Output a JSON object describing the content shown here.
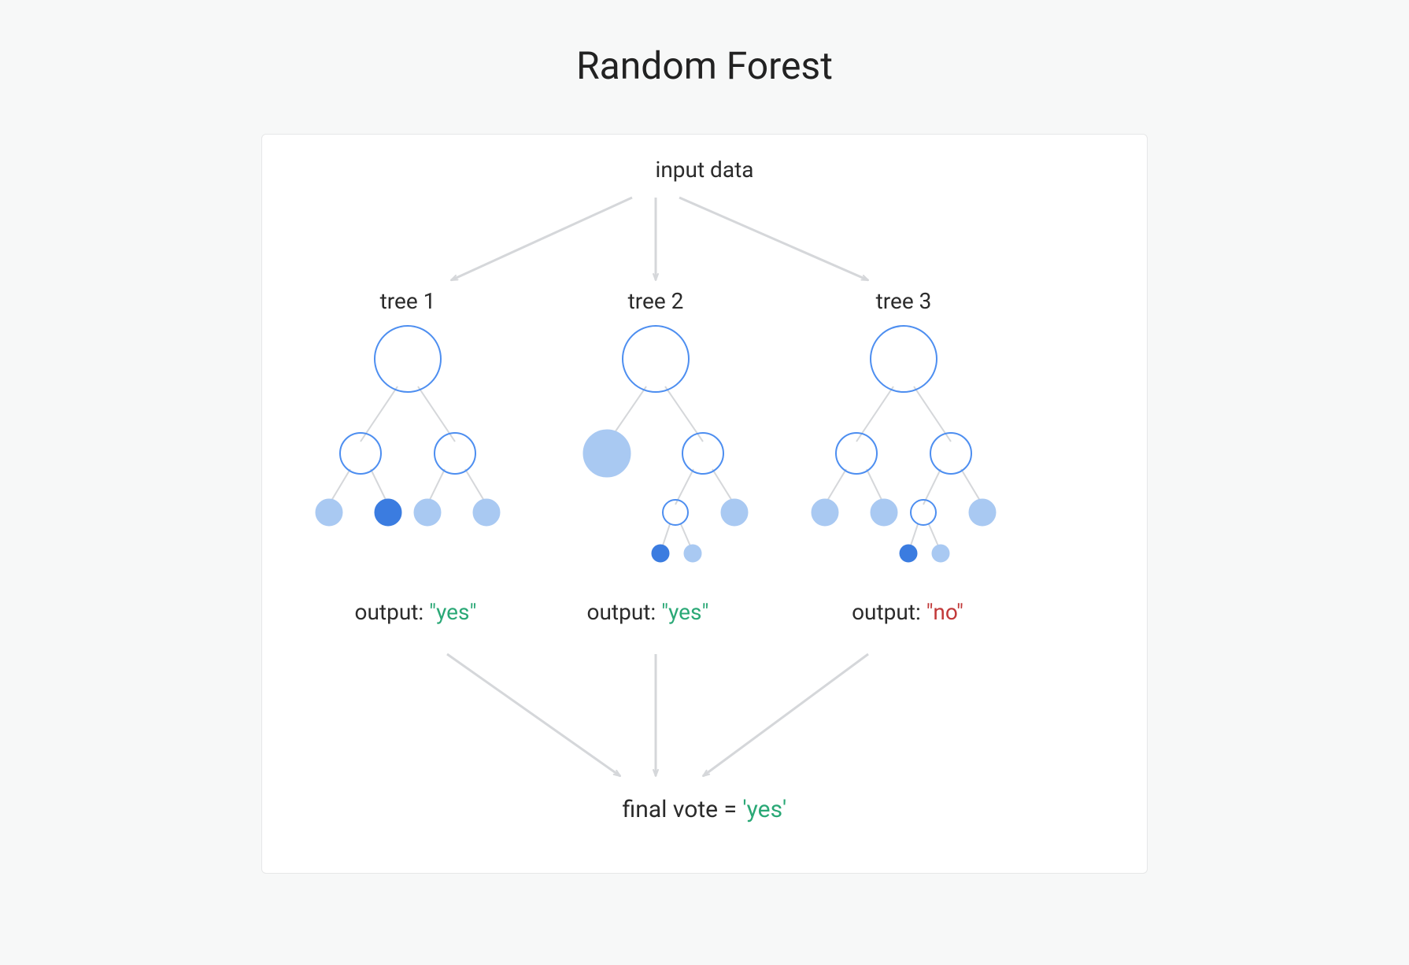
{
  "title": "Random Forest",
  "input_label": "input data",
  "trees": [
    {
      "label": "tree 1",
      "output_prefix": "output: ",
      "output_value": "\"yes\"",
      "output_class": "yes"
    },
    {
      "label": "tree 2",
      "output_prefix": "output: ",
      "output_value": "\"yes\"",
      "output_class": "yes"
    },
    {
      "label": "tree 3",
      "output_prefix": "output: ",
      "output_value": "\"no\"",
      "output_class": "no"
    }
  ],
  "final": {
    "prefix": "final vote = ",
    "value": "'yes'",
    "value_class": "yes"
  },
  "colors": {
    "node_stroke": "#4d8ef0",
    "fill_light": "#a9c9f2",
    "fill_mid": "#6ea8ef",
    "fill_dark": "#3b7ce0",
    "arrow": "#d5d7da",
    "edge": "#d5d7da"
  }
}
